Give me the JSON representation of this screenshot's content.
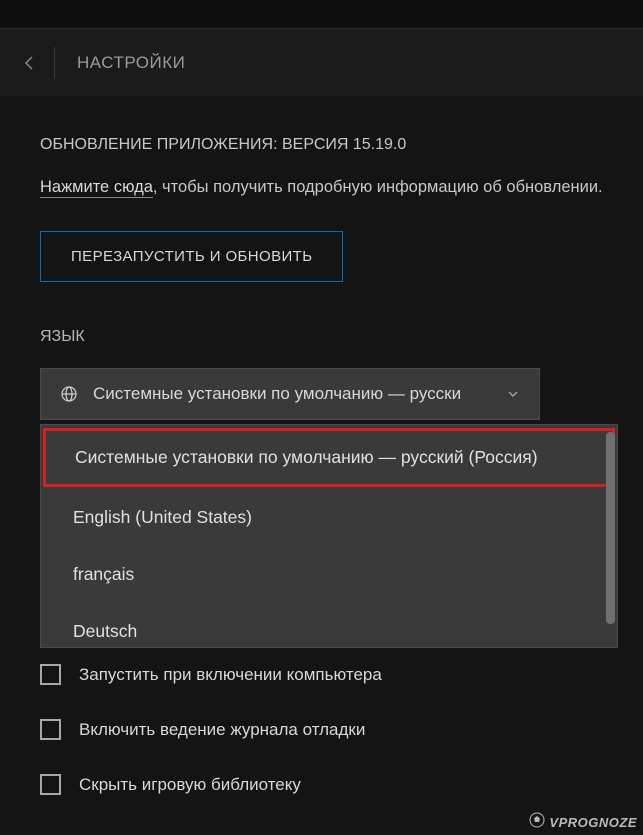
{
  "header": {
    "title": "НАСТРОЙКИ"
  },
  "update": {
    "version_line": "ОБНОВЛЕНИЕ ПРИЛОЖЕНИЯ: ВЕРСИЯ 15.19.0",
    "link_text": "Нажмите сюда",
    "rest_text": ", чтобы получить подробную информацию об обновлении.",
    "restart_button": "ПЕРЕЗАПУСТИТЬ И ОБНОВИТЬ"
  },
  "language": {
    "section_label": "ЯЗЫК",
    "selected": "Системные установки по умолчанию — русски",
    "options": [
      "Системные установки по умолчанию — русский (Россия)",
      "English (United States)",
      "français",
      "Deutsch"
    ]
  },
  "checkboxes": {
    "startup": "Запустить при включении компьютера",
    "debug_log": "Включить ведение журнала отладки",
    "hide_library": "Скрыть игровую библиотеку"
  },
  "watermark": {
    "text": "VPROGNOZE"
  }
}
